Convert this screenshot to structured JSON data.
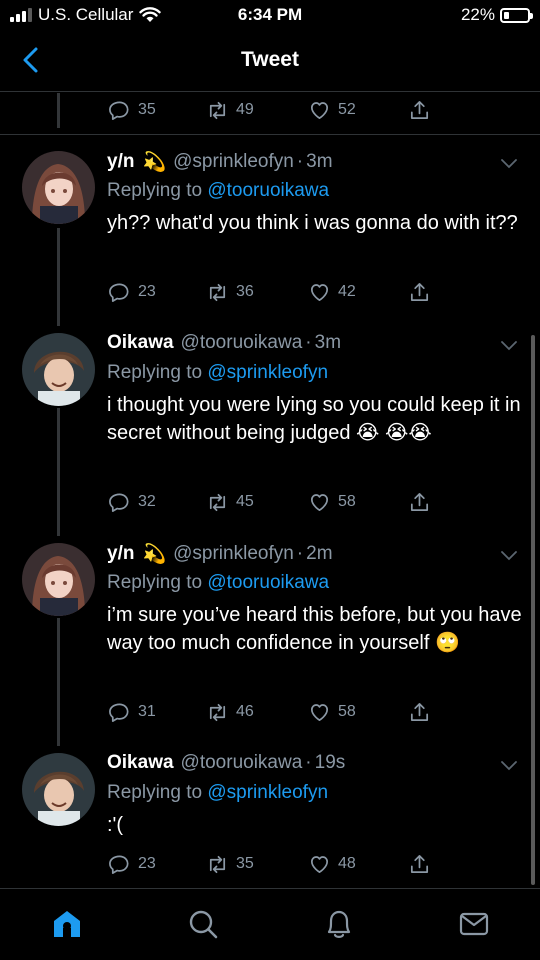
{
  "status": {
    "carrier": "U.S. Cellular",
    "time": "6:34 PM",
    "battery": "22%",
    "battery_level": 0.22
  },
  "nav": {
    "title": "Tweet"
  },
  "top_actions": {
    "replies": "35",
    "retweets": "49",
    "likes": "52"
  },
  "tweets": [
    {
      "name": "y/n",
      "name_emoji": "💫",
      "handle": "@sprinkleofyn",
      "sep": "·",
      "time": "3m",
      "reply_prefix": "Replying to",
      "reply_to": "@tooruoikawa",
      "body": "yh?? what'd you think i was gonna do with it??",
      "replies": "23",
      "retweets": "36",
      "likes": "42"
    },
    {
      "name": "Oikawa",
      "handle": "@tooruoikawa",
      "sep": "·",
      "time": "3m",
      "reply_prefix": "Replying to",
      "reply_to": "@sprinkleofyn",
      "body": "i thought you were lying so you could keep it in secret without being judged 😭 😭😭",
      "replies": "32",
      "retweets": "45",
      "likes": "58"
    },
    {
      "name": "y/n",
      "name_emoji": "💫",
      "handle": "@sprinkleofyn",
      "sep": "·",
      "time": "2m",
      "reply_prefix": "Replying to",
      "reply_to": "@tooruoikawa",
      "body": "i’m sure you’ve heard this before, but you have way too much confidence in yourself 🙄",
      "replies": "31",
      "retweets": "46",
      "likes": "58"
    },
    {
      "name": "Oikawa",
      "handle": "@tooruoikawa",
      "sep": "·",
      "time": "19s",
      "reply_prefix": "Replying to",
      "reply_to": "@sprinkleofyn",
      "body": ":'(",
      "replies": "23",
      "retweets": "35",
      "likes": "48"
    }
  ],
  "tabs": [
    "home-icon",
    "search-icon",
    "notifications-icon",
    "messages-icon"
  ],
  "colors": {
    "accent": "#1d9bf0",
    "muted": "#8b98a5",
    "background": "#000000"
  }
}
